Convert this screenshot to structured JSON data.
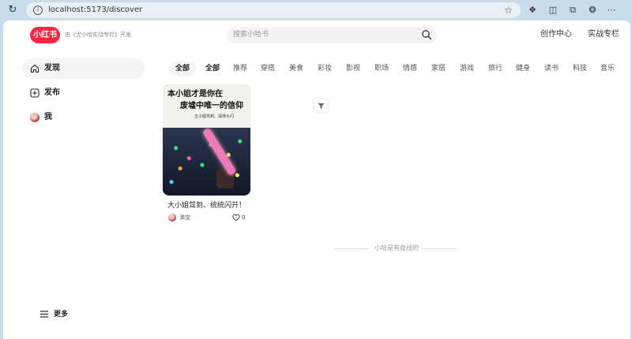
{
  "browser": {
    "url": "localhost:5173/discover"
  },
  "header": {
    "logo_text": "小红书",
    "dev_note": "由《犬小哈实战专栏》开发",
    "search_placeholder": "搜索小哈书",
    "links": [
      "创作中心",
      "实战专栏"
    ]
  },
  "sidebar": {
    "items": [
      {
        "label": "发现",
        "icon": "home-icon",
        "active": true
      },
      {
        "label": "发布",
        "icon": "plus-square-icon",
        "active": false
      },
      {
        "label": "我",
        "icon": "avatar",
        "active": false
      }
    ],
    "more_label": "更多"
  },
  "channels": [
    "全部",
    "全部",
    "推荐",
    "穿搭",
    "美食",
    "彩妆",
    "影视",
    "职场",
    "情感",
    "家居",
    "游戏",
    "旅行",
    "健身",
    "读书",
    "科技",
    "音乐"
  ],
  "feed": {
    "notes": [
      {
        "title": "大小姐驾到、统统闪开！",
        "author": "沸宝",
        "likes": "0",
        "image_text": [
          "本小姐才是你在",
          "废墟中唯一的信仰",
          "五小姐驾到、请准大闪"
        ]
      }
    ],
    "end_text": "小哈是有底线的"
  },
  "colors": {
    "brand": "#ff2442",
    "page_bg": "#ffffff",
    "chrome_bg": "#c9dcea"
  }
}
